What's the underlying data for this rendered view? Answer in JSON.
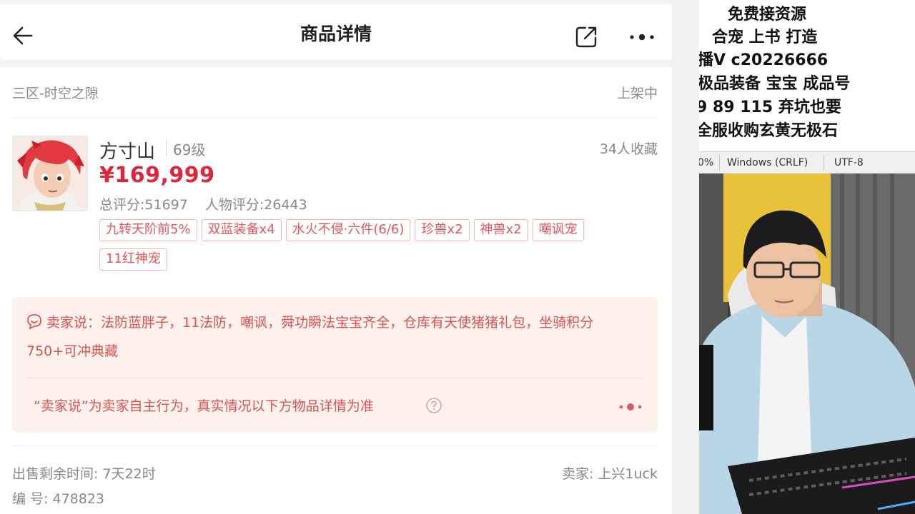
{
  "header": {
    "title": "商品详情"
  },
  "listing": {
    "server": "三区-时空之隙",
    "status": "上架中",
    "school": "方寸山",
    "level": "69级",
    "favorites": "34人收藏",
    "price": "¥169,999",
    "total_score": "总评分:51697",
    "character_score": "人物评分:26443",
    "tags": [
      "九转天阶前5%",
      "双蓝装备x4",
      "水火不侵·六件(6/6)",
      "珍兽x2",
      "神兽x2",
      "嘲讽宠",
      "11红神宠"
    ]
  },
  "seller_note": {
    "text": "卖家说：法防蓝胖子，11法防，嘲讽，舜功瞬法宝宝齐全，仓库有天使猪猪礼包，坐骑积分750+可冲典藏",
    "disclaimer": "“卖家说”为卖家自主行为，真实情况以下方物品详情为准"
  },
  "footer_info": {
    "remaining_time": "出售剩余时间: 7天22时",
    "seller": "卖家: 上兴1uck",
    "item_id": "编 号: 478823"
  },
  "overlay": {
    "lines": [
      "免费接资源",
      "合宠 上书 打造",
      "播V     c20226666",
      "极品装备 宝宝 成品号",
      "9 89 115 弃坑也要",
      "全服收购玄黄无极石"
    ]
  },
  "editor_status": {
    "zoom": "0%",
    "line_ending": "Windows (CRLF)",
    "encoding": "UTF-8"
  },
  "colors": {
    "price": "#e0253b",
    "tag_text": "#e4575c",
    "tag_border": "#f4b3b3",
    "seller_bg": "#fff1ee",
    "seller_text": "#d9534f"
  }
}
